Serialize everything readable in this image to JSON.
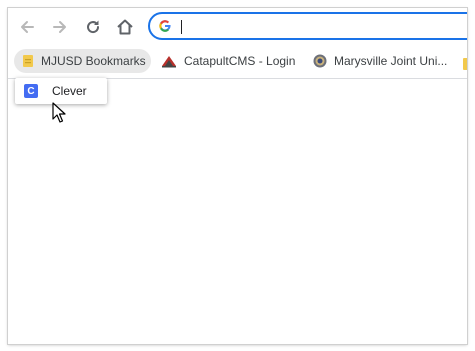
{
  "bookmarks": [
    {
      "label": "MJUSD Bookmarks",
      "icon": "folder-icon"
    },
    {
      "label": "CatapultCMS - Login",
      "icon": "catapult-icon"
    },
    {
      "label": "Marysville Joint Uni...",
      "icon": "district-seal-icon"
    }
  ],
  "dropdown": {
    "items": [
      {
        "label": "Clever",
        "icon": "clever-icon",
        "icon_letter": "C"
      }
    ]
  },
  "omnibox": {
    "value": ""
  },
  "colors": {
    "accent": "#1a73e8",
    "clever": "#436cf2",
    "folder": "#f2c94c"
  }
}
